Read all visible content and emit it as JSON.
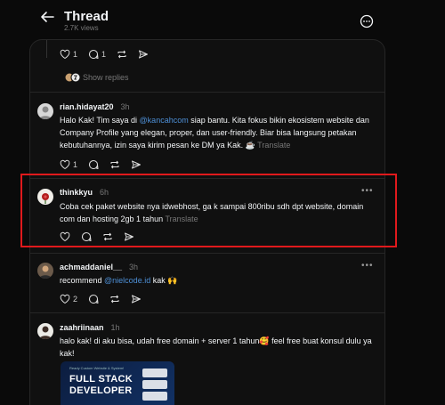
{
  "header": {
    "title": "Thread",
    "views": "2.7K views"
  },
  "top_post": {
    "likes": "1",
    "replies": "1",
    "show_replies": "Show replies"
  },
  "comments": [
    {
      "user": "rian.hidayat20",
      "time": "3h",
      "text_pre": "Halo Kak! Tim saya di ",
      "mention": "@kancahcom",
      "text_post": " siap bantu. Kita fokus bikin ekosistem website dan Company Profile yang elegan, proper, dan user-friendly. Biar bisa langsung petakan kebutuhannya, izin saya kirim pesan ke DM ya Kak. ☕",
      "translate": "Translate",
      "likes": "1"
    },
    {
      "user": "thinkkyu",
      "time": "6h",
      "text": "Coba cek paket website nya idwebhost, ga k sampai 800ribu sdh dpt website, domain com dan hosting 2gb 1 tahun",
      "translate": "Translate"
    },
    {
      "user": "achmaddaniel__",
      "time": "3h",
      "text_pre": "recommend ",
      "mention": "@nielcode.id",
      "text_post": " kak 🙌",
      "likes": "2"
    },
    {
      "user": "zaahriinaan",
      "time": "1h",
      "text": "halo kak! di aku bisa, udah free domain + server 1 tahun🥰 feel free buat konsul dulu ya kak!",
      "promo": {
        "small": "Ready Custom Website & System!",
        "line1": "FULL STACK",
        "line2": "DEVELOPER"
      }
    }
  ],
  "colors": {
    "background": "#0a0a0a",
    "panel": "#101010",
    "mention": "#4d8fd6",
    "highlight": "#e0191c"
  }
}
